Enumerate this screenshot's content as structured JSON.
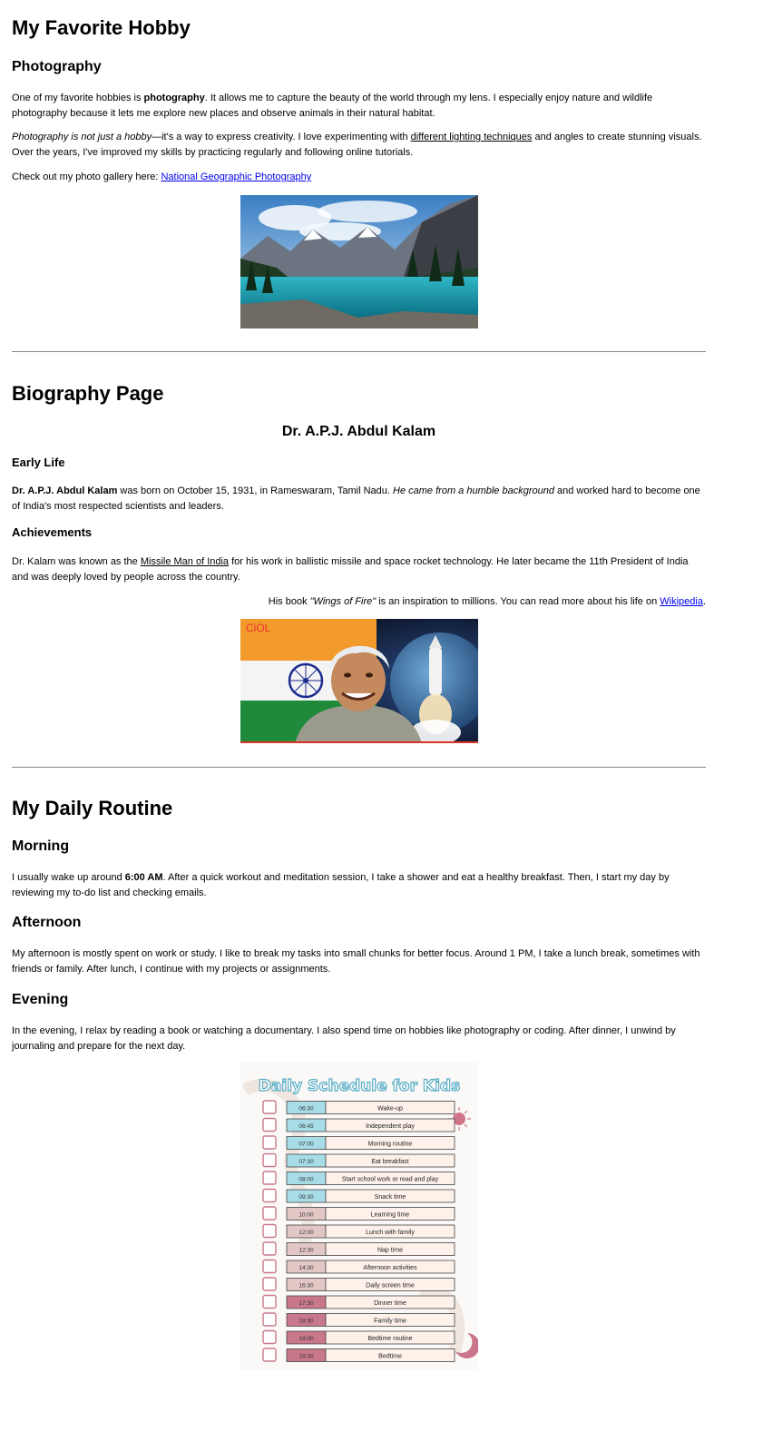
{
  "hobby": {
    "title": "My Favorite Hobby",
    "subtitle": "Photography",
    "p1": {
      "pre": "One of my favorite hobbies is ",
      "bold": "photography",
      "post": ". It allows me to capture the beauty of the world through my lens. I especially enjoy nature and wildlife photography because it lets me explore new places and observe animals in their natural habitat."
    },
    "p2": {
      "italic": "Photography is not just a hobby",
      "mid": "—it's a way to express creativity. I love experimenting with ",
      "underline": "different lighting techniques",
      "post": " and angles to create stunning visuals. Over the years, I've improved my skills by practicing regularly and following online tutorials."
    },
    "p3": {
      "pre": "Check out my photo gallery here: ",
      "link": "National Geographic Photography"
    }
  },
  "biography": {
    "title": "Biography Page",
    "name": "Dr. A.P.J. Abdul Kalam",
    "early_life_heading": "Early Life",
    "early_life": {
      "bold": "Dr. A.P.J. Abdul Kalam",
      "mid": " was born on October 15, 1931, in Rameswaram, Tamil Nadu. ",
      "italic": "He came from a humble background",
      "post": " and worked hard to become one of India's most respected scientists and leaders."
    },
    "achievements_heading": "Achievements",
    "achievements": {
      "pre": "Dr. Kalam was known as the ",
      "underline": "Missile Man of India",
      "post": " for his work in ballistic missile and space rocket technology. He later became the 11th President of India and was deeply loved by people across the country."
    },
    "book": {
      "pre": "His book ",
      "italic": "\"Wings of Fire\"",
      "mid": " is an inspiration to millions. You can read more about his life on ",
      "link": "Wikipedia",
      "post": "."
    },
    "logo_text": "CiOL"
  },
  "routine": {
    "title": "My Daily Routine",
    "morning_heading": "Morning",
    "morning": {
      "pre": "I usually wake up around ",
      "bold": "6:00 AM",
      "post": ". After a quick workout and meditation session, I take a shower and eat a healthy breakfast. Then, I start my day by reviewing my to-do list and checking emails."
    },
    "afternoon_heading": "Afternoon",
    "afternoon": "My afternoon is mostly spent on work or study. I like to break my tasks into small chunks for better focus. Around 1 PM, I take a lunch break, sometimes with friends or family. After lunch, I continue with my projects or assignments.",
    "evening_heading": "Evening",
    "evening": "In the evening, I relax by reading a book or watching a documentary. I also spend time on hobbies like photography or coding. After dinner, I unwind by journaling and prepare for the next day.",
    "schedule": {
      "title": "Daily Schedule for Kids",
      "rows": [
        {
          "time": "06:30",
          "activity": "Wake-up"
        },
        {
          "time": "06:45",
          "activity": "Independent play"
        },
        {
          "time": "07:00",
          "activity": "Morning routine"
        },
        {
          "time": "07:30",
          "activity": "Eat breakfast"
        },
        {
          "time": "08:00",
          "activity": "Start school work or read and play"
        },
        {
          "time": "09:30",
          "activity": "Snack time"
        },
        {
          "time": "10:00",
          "activity": "Learning time"
        },
        {
          "time": "12:00",
          "activity": "Lunch with family"
        },
        {
          "time": "12:30",
          "activity": "Nap time"
        },
        {
          "time": "14:30",
          "activity": "Afternoon activities"
        },
        {
          "time": "16:30",
          "activity": "Daily screen time"
        },
        {
          "time": "17:30",
          "activity": "Dinner time"
        },
        {
          "time": "18:30",
          "activity": "Family time"
        },
        {
          "time": "19:00",
          "activity": "Bedtime routine"
        },
        {
          "time": "19:30",
          "activity": "Bedtime"
        }
      ]
    }
  },
  "colors": {
    "link": "#0000ee",
    "divider": "#888888",
    "schedule_title": "#5aaec6"
  }
}
